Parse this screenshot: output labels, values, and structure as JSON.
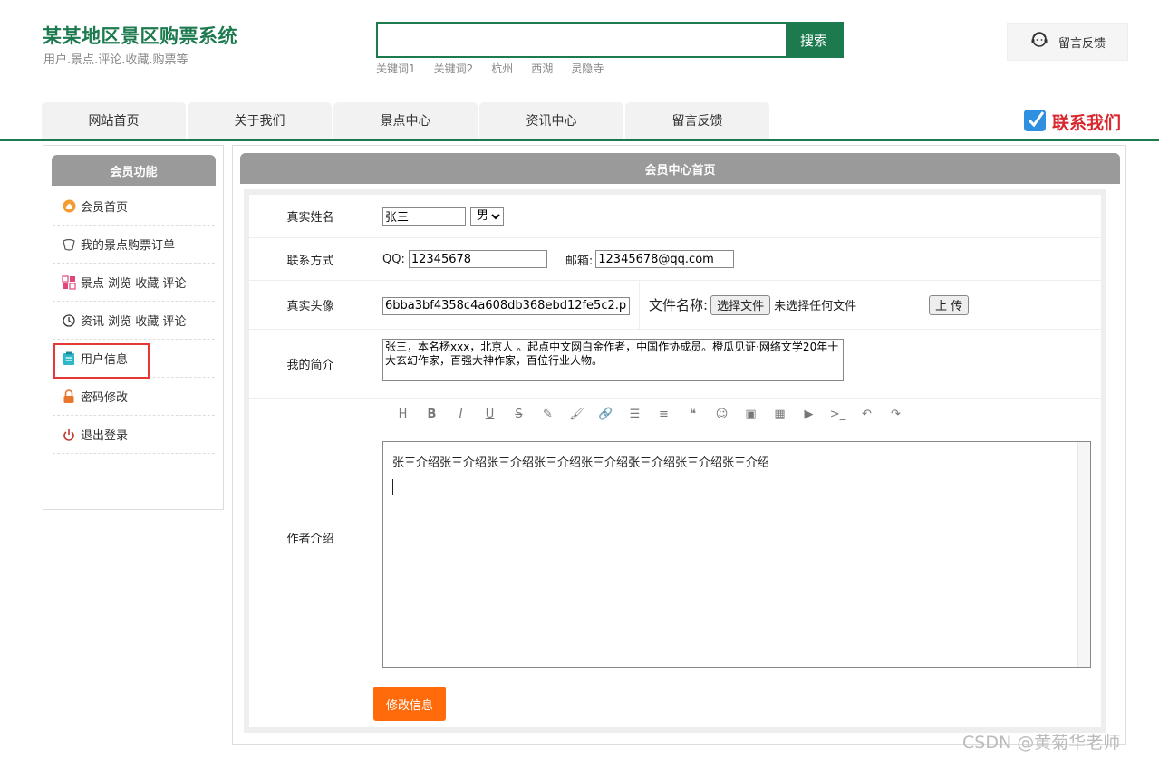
{
  "header": {
    "site_title": "某某地区景区购票系统",
    "site_subtitle": "用户.景点.评论.收藏.购票等",
    "search_placeholder": "",
    "search_button": "搜索",
    "keywords": [
      "关键词1",
      "关键词2",
      "杭州",
      "西湖",
      "灵隐寺"
    ],
    "feedback_button": "留言反馈"
  },
  "nav": {
    "tabs": [
      "网站首页",
      "关于我们",
      "景点中心",
      "资讯中心",
      "留言反馈"
    ],
    "contact": "联系我们"
  },
  "sidebar": {
    "title": "会员功能",
    "items": [
      {
        "label": "会员首页",
        "icon": "home-icon"
      },
      {
        "label": "我的景点购票订单",
        "icon": "ticket-icon"
      },
      {
        "label": "景点 浏览 收藏 评论",
        "icon": "grid-icon"
      },
      {
        "label": "资讯 浏览 收藏 评论",
        "icon": "history-icon"
      },
      {
        "label": "用户信息",
        "icon": "clipboard-icon"
      },
      {
        "label": "密码修改",
        "icon": "lock-icon"
      },
      {
        "label": "退出登录",
        "icon": "power-icon"
      }
    ]
  },
  "main": {
    "title": "会员中心首页",
    "form": {
      "name_label": "真实姓名",
      "name_value": "张三",
      "gender_value": "男",
      "contact_label": "联系方式",
      "qq_label": "QQ:",
      "qq_value": "12345678",
      "email_label": "邮箱:",
      "email_value": "12345678@qq.com",
      "avatar_label": "真实头像",
      "avatar_value": "6bba3bf4358c4a608db368ebd12fe5c2.png",
      "file_name_label": "文件名称:",
      "choose_file_button": "选择文件",
      "no_file_text": "未选择任何文件",
      "upload_button": "上 传",
      "bio_label": "我的简介",
      "bio_value": "张三，本名杨xxx，北京人 。起点中文网白金作者，中国作协成员。橙瓜见证·网络文学20年十大玄幻作家，百强大神作家，百位行业人物。",
      "author_intro_label": "作者介绍",
      "editor_content": "张三介绍张三介绍张三介绍张三介绍张三介绍张三介绍张三介绍张三介绍",
      "toolbar_icons": [
        "H",
        "B",
        "I",
        "U",
        "S",
        "✎",
        "🖌",
        "🔗",
        "☰",
        "≡",
        "❝",
        "☺",
        "▣",
        "▦",
        "▶",
        ">_",
        "↶",
        "↷"
      ],
      "submit_button": "修改信息"
    }
  },
  "watermark": "CSDN @黄菊华老师",
  "colors": {
    "brand": "#1d7a4f",
    "accent": "#ff6a0b",
    "header_gray": "#9a9a9a",
    "highlight": "#e53935",
    "contact": "#d9272e"
  }
}
